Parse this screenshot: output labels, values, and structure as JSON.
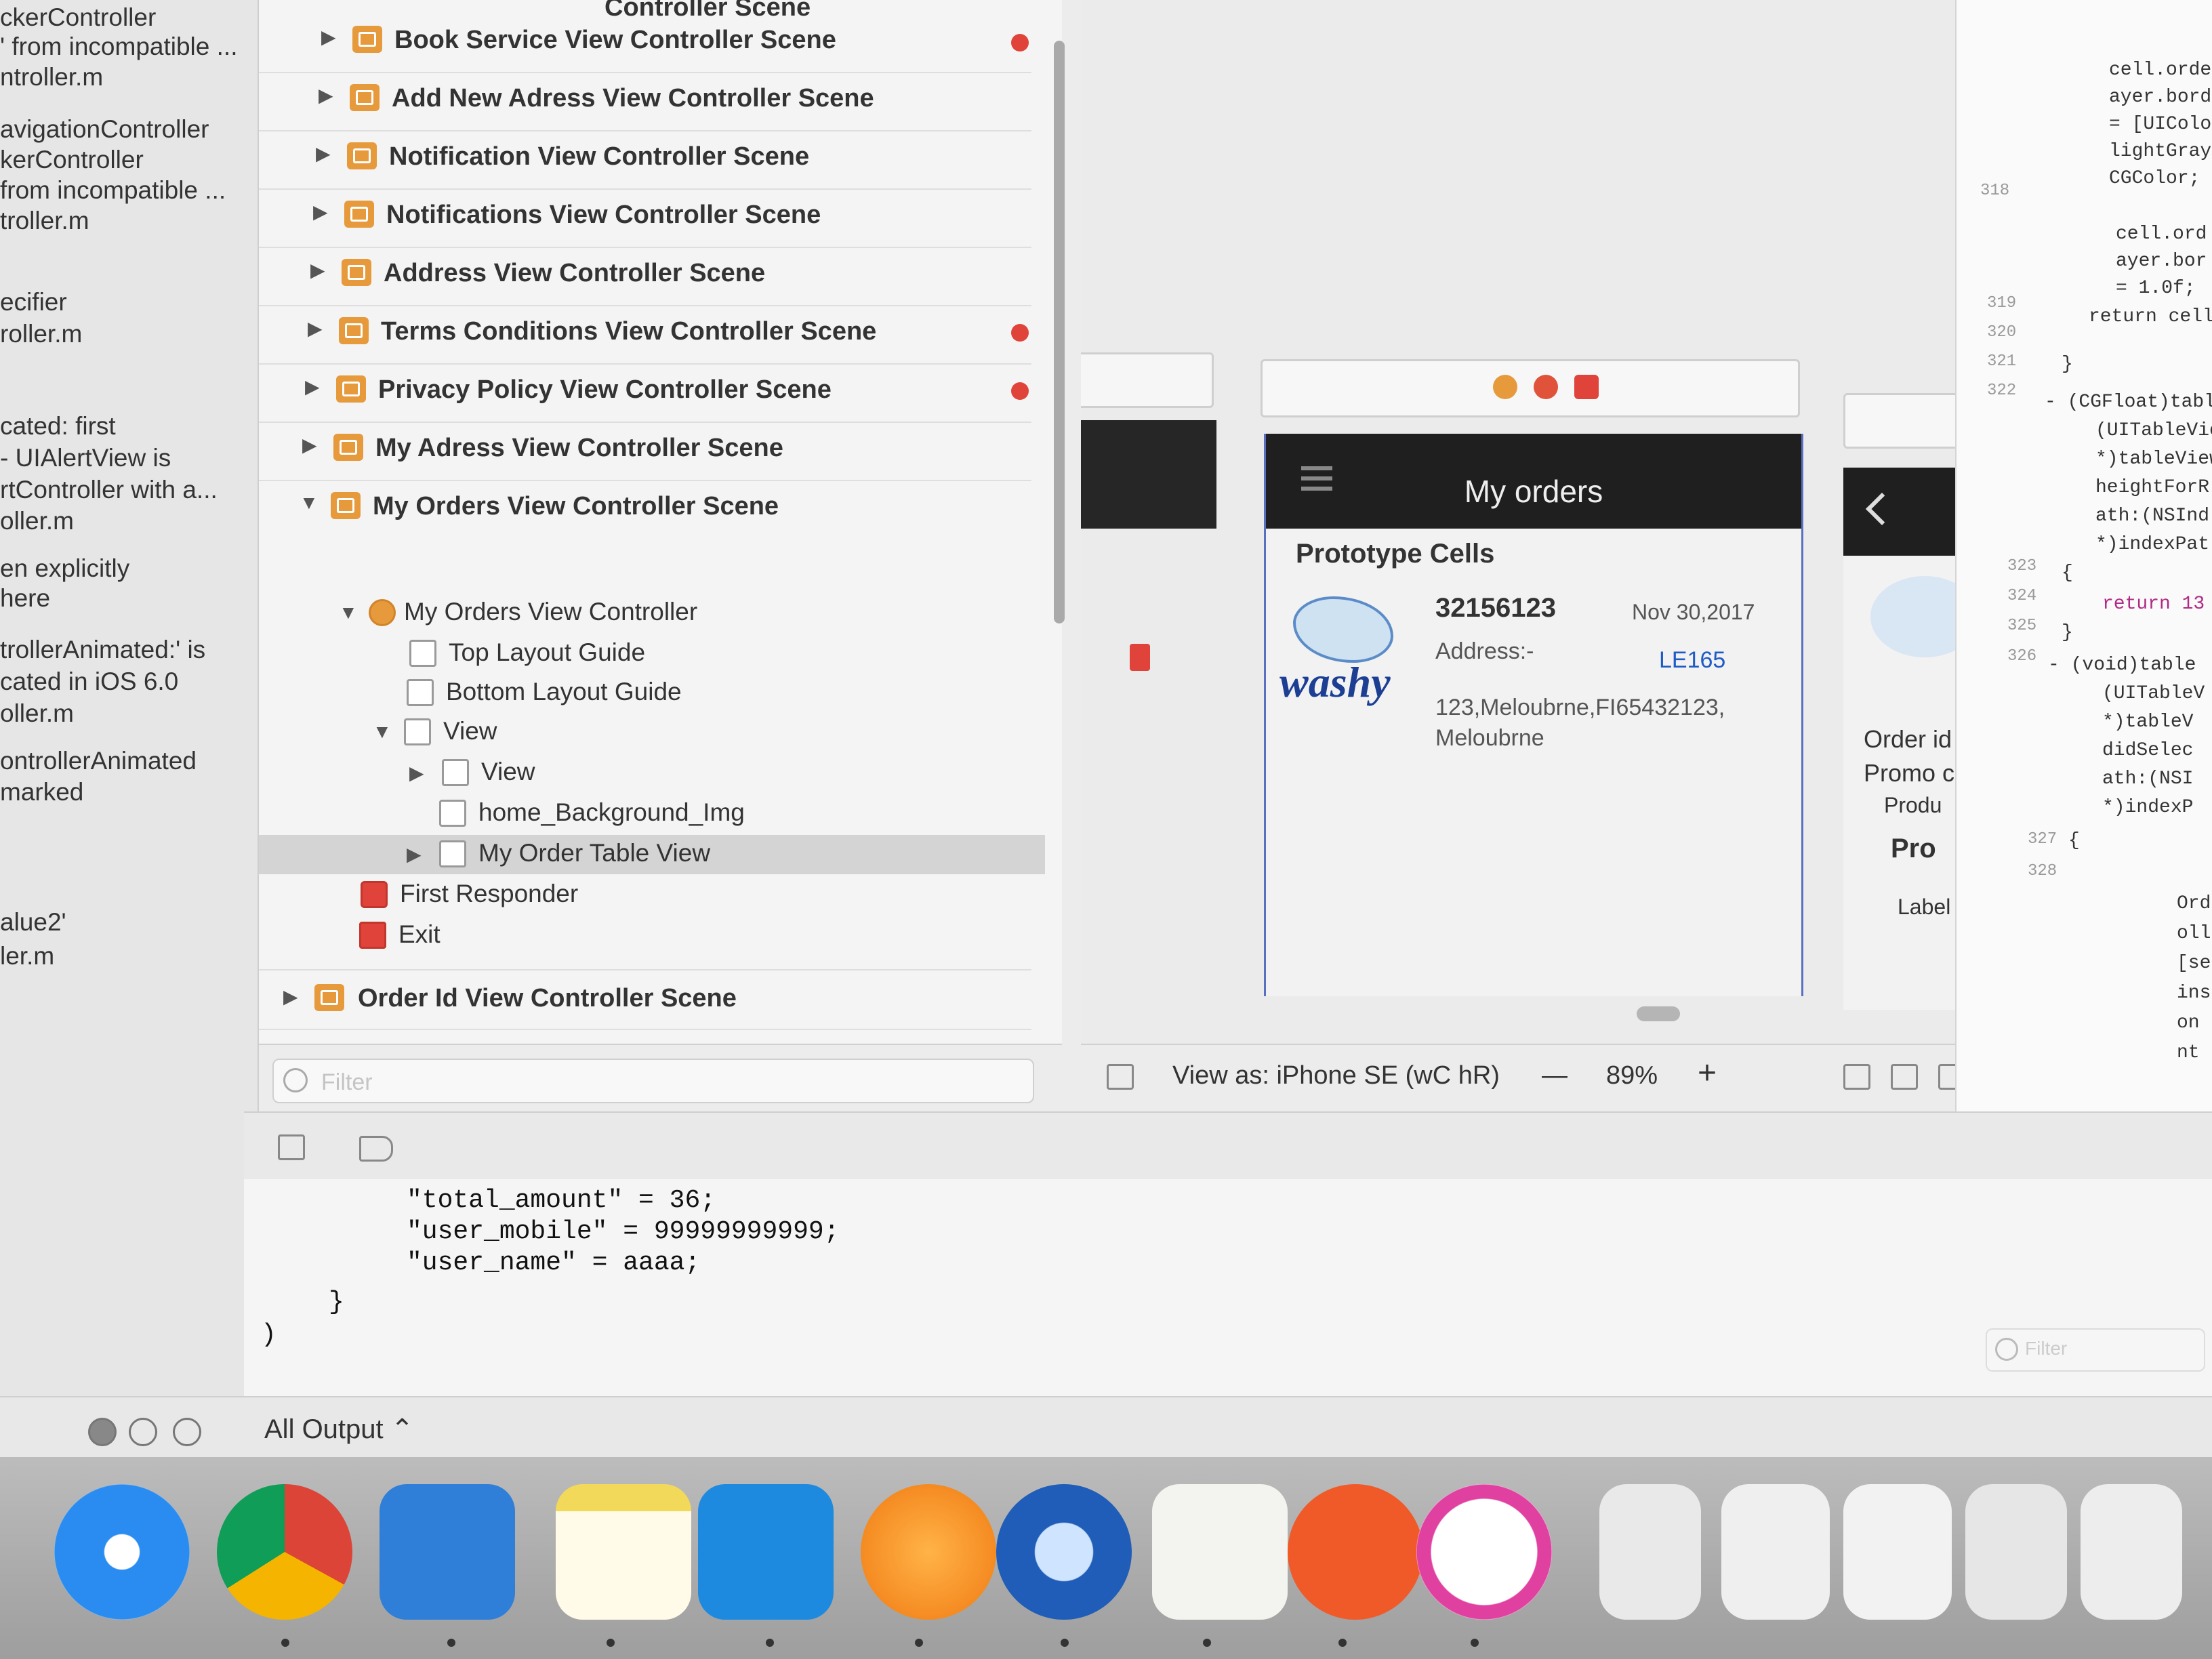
{
  "issue_navigator": {
    "lines": [
      "ckerController",
      "' from incompatible ...",
      "ntroller.m",
      "avigationController",
      "kerController",
      " from incompatible ...",
      "troller.m",
      "ecifier",
      "roller.m",
      "cated: first",
      " - UIAlertView is",
      "rtController with a...",
      "oller.m",
      "en explicitly",
      "here",
      "trollerAnimated:' is",
      "cated in iOS 6.0",
      "oller.m",
      "ontrollerAnimated",
      "marked",
      "alue2'",
      "ler.m"
    ]
  },
  "outline": {
    "partial_top": "Controller Scene",
    "scenes_top": [
      {
        "label": "Book Service View Controller Scene",
        "warning": true
      },
      {
        "label": "Add New Adress View Controller Scene",
        "warning": false
      },
      {
        "label": "Notification View Controller Scene",
        "warning": false
      },
      {
        "label": "Notifications View Controller Scene",
        "warning": false
      },
      {
        "label": "Address View Controller Scene",
        "warning": false
      },
      {
        "label": "Terms Conditions View Controller Scene",
        "warning": true
      },
      {
        "label": "Privacy Policy View Controller Scene",
        "warning": true
      },
      {
        "label": "My Adress View Controller Scene",
        "warning": false
      },
      {
        "label": "My Orders View Controller Scene",
        "warning": false
      }
    ],
    "tree": [
      {
        "label": "My Orders View Controller",
        "icon": "view-controller-icon"
      },
      {
        "label": "Top Layout Guide",
        "icon": "layout-guide-icon"
      },
      {
        "label": "Bottom Layout Guide",
        "icon": "layout-guide-icon"
      },
      {
        "label": "View",
        "icon": "view-icon"
      },
      {
        "label": "View",
        "icon": "view-icon"
      },
      {
        "label": "home_Background_Img",
        "icon": "image-view-icon"
      },
      {
        "label": "My Order Table View",
        "icon": "table-view-icon",
        "selected": true
      },
      {
        "label": "First Responder",
        "icon": "first-responder-icon"
      },
      {
        "label": "Exit",
        "icon": "exit-icon"
      }
    ],
    "scene_bottom": "Order Id View Controller Scene",
    "filter_placeholder": "Filter"
  },
  "canvas": {
    "nav_title": "My orders",
    "prototype_label": "Prototype Cells",
    "cell": {
      "logo_text": "washy",
      "order_id": "32156123",
      "date": "Nov 30,2017",
      "address_label": "Address:-",
      "code": "LE165",
      "address_line1": "123,Meloubrne,FI65432123,",
      "address_line2": "Meloubrne"
    },
    "right_scene_labels": [
      "Order id",
      "Promo c",
      "Produ",
      "Pro",
      "Label"
    ],
    "toolbar": {
      "view_as": "View as: iPhone SE (wC hR)",
      "minus": "—",
      "zoom": "89%",
      "plus": "+"
    }
  },
  "code_editor": {
    "line_numbers": [
      "318",
      "319",
      "320",
      "321",
      "322",
      "323",
      "324",
      "325",
      "326",
      "327",
      "328"
    ],
    "lines": [
      "cell.order",
      "ayer.borde",
      "= [UIColo",
      "lightGray",
      "CGColor;",
      "cell.ord",
      "ayer.bor",
      "= 1.0f;",
      "return cell;",
      "}",
      "- (CGFloat)tabl",
      "(UITableVie",
      "*)tableView",
      "heightForR",
      "ath:(NSInd",
      "*)indexPat",
      "{",
      "return 13",
      "}",
      "- (void)table",
      "(UITableV",
      "*)tableV",
      "didSelec",
      "ath:(NSI",
      "*)indexP",
      "{",
      "Ord",
      "oll",
      "[se",
      "ins",
      "on",
      "nt"
    ]
  },
  "console": {
    "lines": [
      "\"total_amount\" = 36;",
      "\"user_mobile\" = 99999999999;",
      "\"user_name\" = aaaa;",
      "}",
      ")"
    ],
    "filter_placeholder": "Filter",
    "output_selector": "All Output ⌃"
  },
  "dock": {
    "apps": [
      "Safari",
      "Google Chrome",
      "Simulator",
      "Notes",
      "Xcode",
      "Sublime",
      "Thunderbird",
      "TextEdit",
      "Pixelmator",
      "iTunes"
    ]
  }
}
